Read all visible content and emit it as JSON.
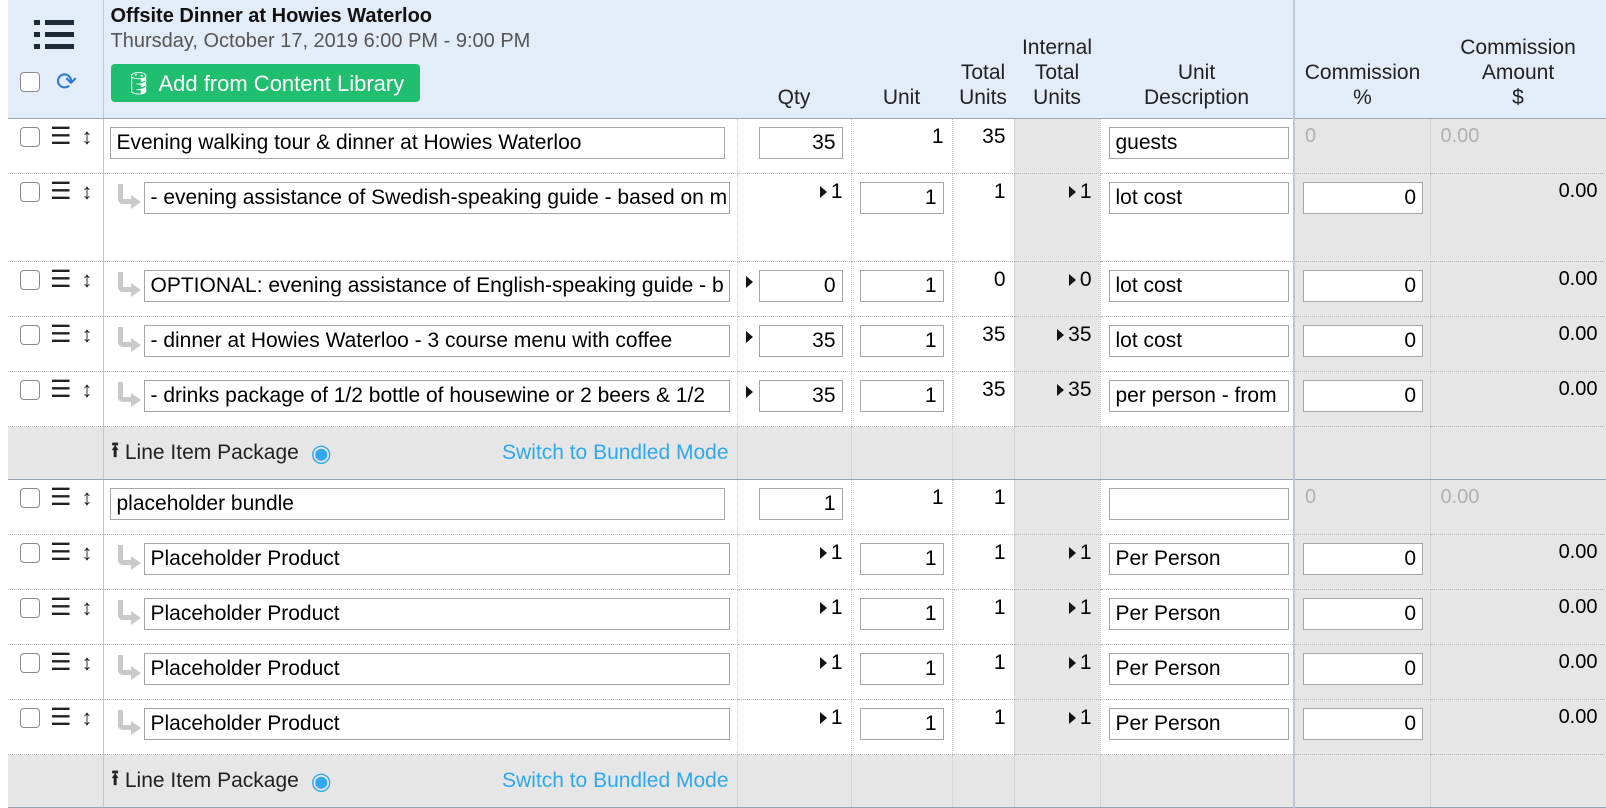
{
  "header": {
    "event_title": "Offsite Dinner at Howies Waterloo",
    "event_date": "Thursday, October 17, 2019 6:00 PM - 9:00 PM",
    "add_button_label": "Add from Content Library",
    "columns": {
      "qty": "Qty",
      "unit": "Unit",
      "total_units_1": "Total",
      "total_units_2": "Units",
      "internal_1": "Internal",
      "internal_2": "Total",
      "internal_3": "Units",
      "unit_desc_1": "Unit",
      "unit_desc_2": "Description",
      "comm_pct_1": "Commission",
      "comm_pct_2": "%",
      "comm_amt_1": "Commission",
      "comm_amt_2": "Amount",
      "comm_amt_3": "$"
    }
  },
  "groups": [
    {
      "parent": {
        "desc": "Evening walking tour & dinner at Howies Waterloo",
        "qty": "35",
        "unit": "1",
        "total_units": "35",
        "unit_desc": "guests",
        "comm_pct": "0",
        "comm_amt": "0.00"
      },
      "children": [
        {
          "desc": "- evening assistance of Swedish-speaking guide - based on m",
          "qty": "1",
          "unit": "1",
          "total_units": "1",
          "internal": "1",
          "unit_desc": "lot cost",
          "comm_pct": "0",
          "comm_amt": "0.00"
        },
        {
          "desc": "OPTIONAL: evening assistance of English-speaking guide - b",
          "qty": "0",
          "unit": "1",
          "total_units": "0",
          "internal": "0",
          "unit_desc": "lot cost",
          "comm_pct": "0",
          "comm_amt": "0.00"
        },
        {
          "desc": "- dinner at Howies Waterloo - 3 course menu with coffee",
          "qty": "35",
          "unit": "1",
          "total_units": "35",
          "internal": "35",
          "unit_desc": "lot cost",
          "comm_pct": "0",
          "comm_amt": "0.00"
        },
        {
          "desc": "- drinks package of 1/2 bottle of housewine or 2 beers & 1/2",
          "qty": "35",
          "unit": "1",
          "total_units": "35",
          "internal": "35",
          "unit_desc": "per person - from",
          "comm_pct": "0",
          "comm_amt": "0.00"
        }
      ],
      "package_label": "Line Item Package",
      "switch_label": "Switch to Bundled Mode"
    },
    {
      "parent": {
        "desc": "placeholder bundle",
        "qty": "1",
        "unit": "1",
        "total_units": "1",
        "unit_desc": "",
        "comm_pct": "0",
        "comm_amt": "0.00"
      },
      "children": [
        {
          "desc": "Placeholder Product",
          "qty": "1",
          "unit": "1",
          "total_units": "1",
          "internal": "1",
          "unit_desc": "Per Person",
          "comm_pct": "0",
          "comm_amt": "0.00"
        },
        {
          "desc": "Placeholder Product",
          "qty": "1",
          "unit": "1",
          "total_units": "1",
          "internal": "1",
          "unit_desc": "Per Person",
          "comm_pct": "0",
          "comm_amt": "0.00"
        },
        {
          "desc": "Placeholder Product",
          "qty": "1",
          "unit": "1",
          "total_units": "1",
          "internal": "1",
          "unit_desc": "Per Person",
          "comm_pct": "0",
          "comm_amt": "0.00"
        },
        {
          "desc": "Placeholder Product",
          "qty": "1",
          "unit": "1",
          "total_units": "1",
          "internal": "1",
          "unit_desc": "Per Person",
          "comm_pct": "0",
          "comm_amt": "0.00"
        }
      ],
      "package_label": "Line Item Package",
      "switch_label": "Switch to Bundled Mode"
    }
  ]
}
